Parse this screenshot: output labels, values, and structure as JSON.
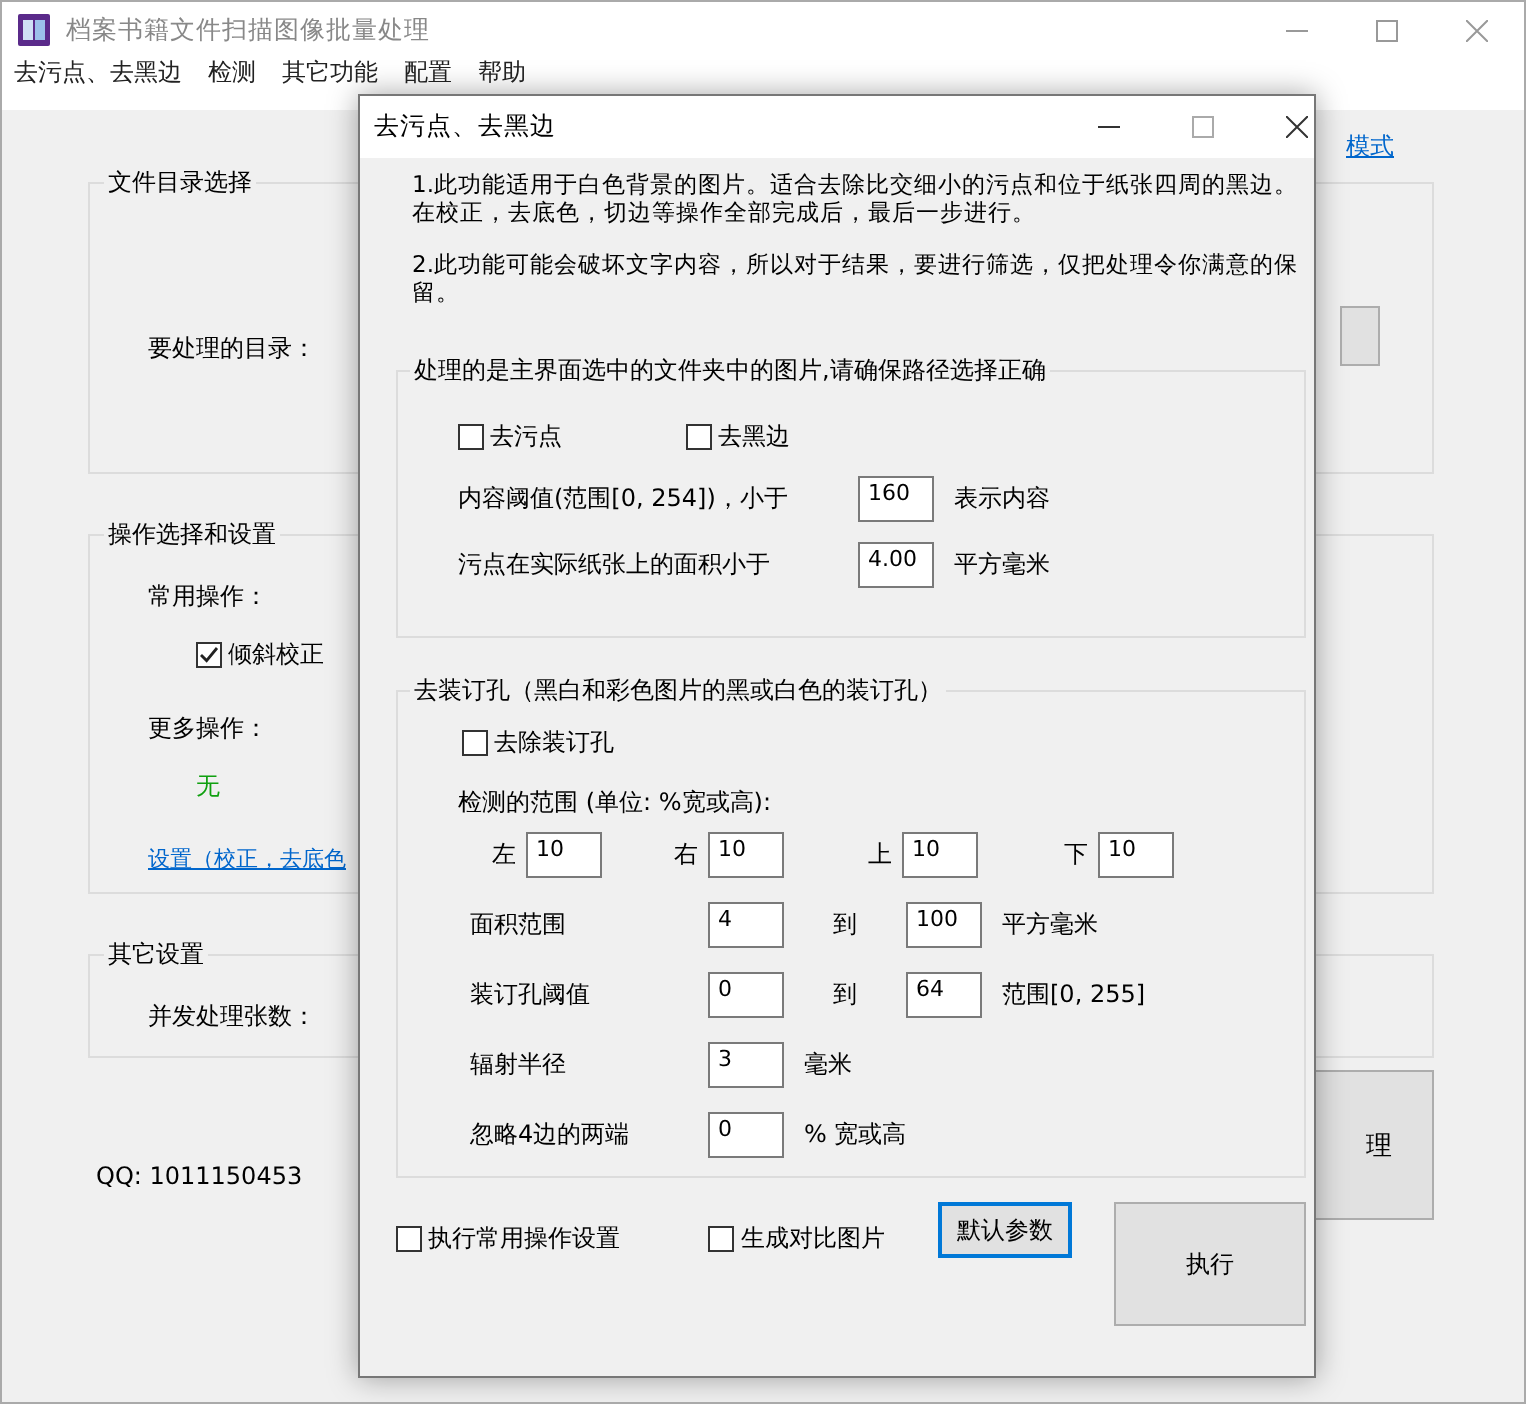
{
  "window": {
    "title": "档案书籍文件扫描图像批量处理"
  },
  "menu": [
    {
      "label": "去污点、去黑边"
    },
    {
      "label": "检测"
    },
    {
      "label": "其它功能"
    },
    {
      "label": "配置"
    },
    {
      "label": "帮助"
    }
  ],
  "mode_link": "模式",
  "dir_group": {
    "legend": "文件目录选择",
    "label": "要处理的目录："
  },
  "ops_group": {
    "legend": "操作选择和设置",
    "common_label": "常用操作：",
    "common_option": {
      "label": "倾斜校正",
      "checked": true
    },
    "more_label": "更多操作：",
    "more_value": "无",
    "settings_link": "设置（校正，去底色"
  },
  "other_group": {
    "legend": "其它设置",
    "label": "并发处理张数："
  },
  "qq": "QQ: 1011150453",
  "process_button": "理",
  "dialog": {
    "title": "去污点、去黑边",
    "notes": [
      {
        "lines": [
          "1.此功能适用于白色背景的图片。适合去除比交细小的污点和位于纸张四周的黑边。",
          "在校正，去底色，切边等操作全部完成后，最后一步进行。"
        ]
      },
      {
        "lines": [
          "2.此功能可能会破坏文字内容，所以对于结果，要进行筛选，仅把处理令你满意的保",
          "留。"
        ]
      }
    ],
    "content_group": {
      "legend": "处理的是主界面选中的文件夹中的图片,请确保路径选择正确",
      "checkboxes": [
        {
          "label": "去污点",
          "checked": false
        },
        {
          "label": "去黑边",
          "checked": false
        }
      ],
      "rows": [
        {
          "label": "内容阈值(范围[0, 254])，小于",
          "value": "160",
          "unit": "表示内容"
        },
        {
          "label": "污点在实际纸张上的面积小于",
          "value": "4.00",
          "unit": "平方毫米"
        }
      ]
    },
    "binding_group": {
      "legend": "去装订孔（黑白和彩色图片的黑或白色的装订孔）",
      "checkbox": {
        "label": "去除装订孔",
        "checked": false
      },
      "range_label": "检测的范围 (单位: %宽或高):",
      "range": [
        {
          "label": "左",
          "value": "10"
        },
        {
          "label": "右",
          "value": "10"
        },
        {
          "label": "上",
          "value": "10"
        },
        {
          "label": "下",
          "value": "10"
        }
      ],
      "rows": [
        {
          "label": "面积范围",
          "value": "4",
          "to_label": "到",
          "to_value": "100",
          "unit": "平方毫米"
        },
        {
          "label": "装订孔阈值",
          "value": "0",
          "to_label": "到",
          "to_value": "64",
          "unit": "范围[0, 255]"
        },
        {
          "label": "辐射半径",
          "value": "3",
          "unit": "毫米"
        },
        {
          "label": "忽略4边的两端",
          "value": "0",
          "unit": "% 宽或高"
        }
      ]
    },
    "options": [
      {
        "label": "执行常用操作设置",
        "checked": false
      },
      {
        "label": "生成对比图片",
        "checked": false
      }
    ],
    "buttons": [
      {
        "label": "默认参数",
        "focused": true,
        "kind": "small"
      },
      {
        "label": "执行",
        "focused": false,
        "kind": "large"
      }
    ]
  }
}
